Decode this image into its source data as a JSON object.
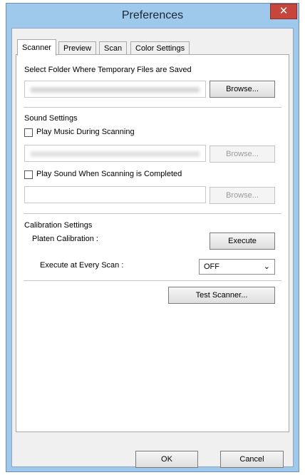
{
  "window": {
    "title": "Preferences",
    "close_glyph": "✕"
  },
  "tabs": [
    {
      "label": "Scanner",
      "active": true
    },
    {
      "label": "Preview",
      "active": false
    },
    {
      "label": "Scan",
      "active": false
    },
    {
      "label": "Color Settings",
      "active": false
    }
  ],
  "temp_folder": {
    "heading": "Select Folder Where Temporary Files are Saved",
    "browse_label": "Browse..."
  },
  "sound": {
    "heading": "Sound Settings",
    "music_checkbox_label": "Play Music During Scanning",
    "music_checked": false,
    "music_browse_label": "Browse...",
    "complete_checkbox_label": "Play Sound When Scanning is Completed",
    "complete_checked": false,
    "complete_browse_label": "Browse..."
  },
  "calibration": {
    "heading": "Calibration Settings",
    "platen_label": "Platen Calibration :",
    "execute_label": "Execute",
    "every_scan_label": "Execute at Every Scan :",
    "every_scan_value": "OFF"
  },
  "test_scanner_label": "Test Scanner...",
  "footer": {
    "ok_label": "OK",
    "cancel_label": "Cancel"
  },
  "icons": {
    "close": "close-icon",
    "dropdown": "chevron-down-icon"
  },
  "colors": {
    "title_bar": "#9fc9ec",
    "close_button": "#c7463c"
  }
}
